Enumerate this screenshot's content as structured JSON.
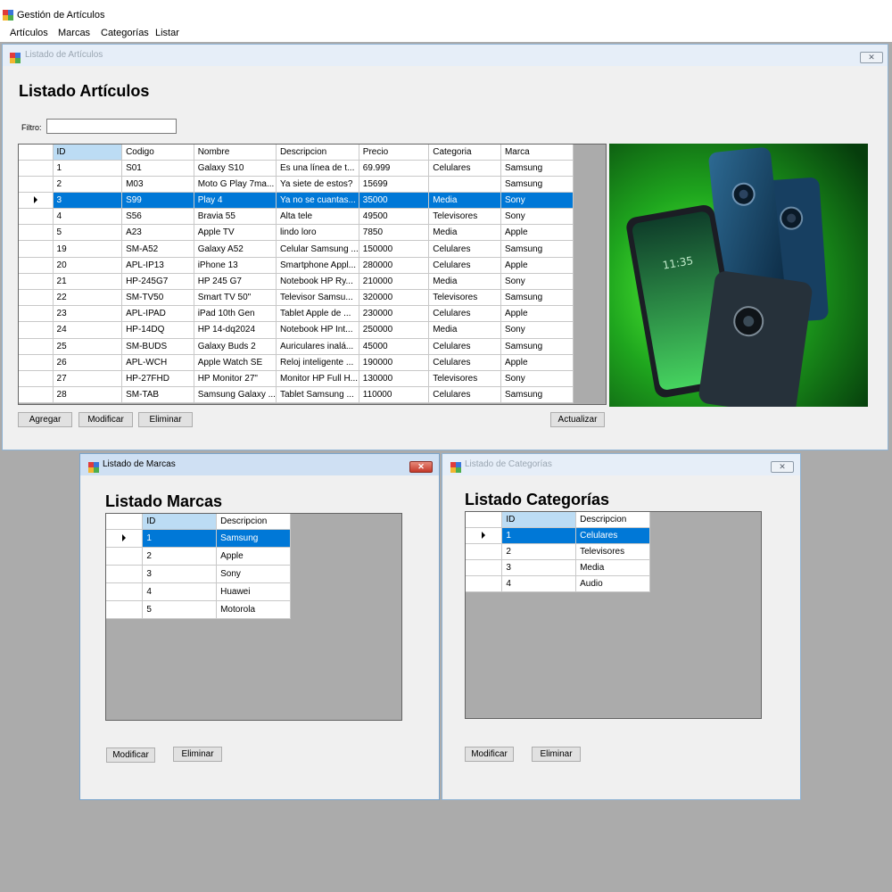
{
  "app": {
    "title": "Gestión de Artículos"
  },
  "menu": [
    "Artículos",
    "Marcas",
    "Categorías",
    "Listar"
  ],
  "articulos_window": {
    "title": "Listado de Artículos",
    "close": "✕",
    "heading": "Listado Artículos",
    "filter_label": "Filtro:",
    "filter_value": "",
    "columns": [
      "ID",
      "Codigo",
      "Nombre",
      "Descripcion",
      "Precio",
      "Categoria",
      "Marca"
    ],
    "rows": [
      [
        "1",
        "S01",
        "Galaxy S10",
        "Es una línea de t...",
        "69.999",
        "Celulares",
        "Samsung"
      ],
      [
        "2",
        "M03",
        "Moto G Play 7ma...",
        "Ya siete de estos?",
        "15699",
        "",
        "Samsung"
      ],
      [
        "3",
        "S99",
        "Play 4",
        "Ya no se cuantas...",
        "35000",
        "Media",
        "Sony"
      ],
      [
        "4",
        "S56",
        "Bravia 55",
        "Alta tele",
        "49500",
        "Televisores",
        "Sony"
      ],
      [
        "5",
        "A23",
        "Apple TV",
        "lindo loro",
        "7850",
        "Media",
        "Apple"
      ],
      [
        "19",
        "SM-A52",
        "Galaxy A52",
        "Celular Samsung ...",
        "150000",
        "Celulares",
        "Samsung"
      ],
      [
        "20",
        "APL-IP13",
        "iPhone 13",
        "Smartphone Appl...",
        "280000",
        "Celulares",
        "Apple"
      ],
      [
        "21",
        "HP-245G7",
        "HP 245 G7",
        "Notebook HP Ry...",
        "210000",
        "Media",
        "Sony"
      ],
      [
        "22",
        "SM-TV50",
        "Smart TV 50\"",
        "Televisor Samsu...",
        "320000",
        "Televisores",
        "Samsung"
      ],
      [
        "23",
        "APL-IPAD",
        "iPad 10th Gen",
        "Tablet Apple de ...",
        "230000",
        "Celulares",
        "Apple"
      ],
      [
        "24",
        "HP-14DQ",
        "HP 14-dq2024",
        "Notebook HP Int...",
        "250000",
        "Media",
        "Sony"
      ],
      [
        "25",
        "SM-BUDS",
        "Galaxy Buds 2",
        "Auriculares inalá...",
        "45000",
        "Celulares",
        "Samsung"
      ],
      [
        "26",
        "APL-WCH",
        "Apple Watch SE",
        "Reloj inteligente ...",
        "190000",
        "Celulares",
        "Apple"
      ],
      [
        "27",
        "HP-27FHD",
        "HP Monitor 27\"",
        "Monitor HP Full H...",
        "130000",
        "Televisores",
        "Sony"
      ],
      [
        "28",
        "SM-TAB",
        "Samsung Galaxy ...",
        "Tablet Samsung ...",
        "110000",
        "Celulares",
        "Samsung"
      ]
    ],
    "selected_row": 2,
    "buttons": {
      "add": "Agregar",
      "edit": "Modificar",
      "delete": "Eliminar",
      "refresh": "Actualizar"
    }
  },
  "marcas_window": {
    "title": "Listado de Marcas",
    "close": "✕",
    "heading": "Listado Marcas",
    "columns": [
      "ID",
      "Descripcion"
    ],
    "rows": [
      [
        "1",
        "Samsung"
      ],
      [
        "2",
        "Apple"
      ],
      [
        "3",
        "Sony"
      ],
      [
        "4",
        "Huawei"
      ],
      [
        "5",
        "Motorola"
      ]
    ],
    "selected_row": 0,
    "buttons": {
      "edit": "Modificar",
      "delete": "Eliminar"
    }
  },
  "categorias_window": {
    "title": "Listado de Categorías",
    "close": "✕",
    "heading": "Listado Categorías",
    "columns": [
      "ID",
      "Descripcion"
    ],
    "rows": [
      [
        "1",
        "Celulares"
      ],
      [
        "2",
        "Televisores"
      ],
      [
        "3",
        "Media"
      ],
      [
        "4",
        "Audio"
      ]
    ],
    "selected_row": 0,
    "buttons": {
      "edit": "Modificar",
      "delete": "Eliminar"
    }
  },
  "colors": {
    "selection": "#0078d7",
    "grid_background": "#ababab",
    "window_background": "#f0f0f0",
    "image_background": "#2fb82a"
  }
}
